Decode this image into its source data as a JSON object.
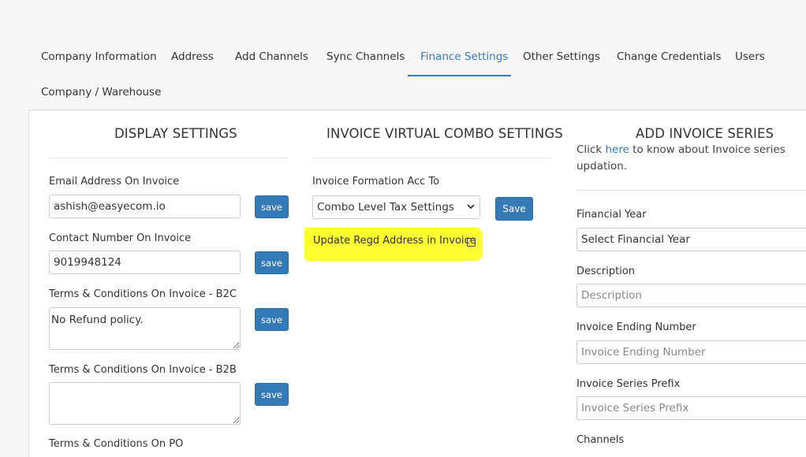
{
  "tabs": {
    "company_info": "Company Information",
    "address": "Address",
    "add_channels": "Add Channels",
    "sync_channels": "Sync Channels",
    "finance_settings": "Finance Settings",
    "other_settings": "Other Settings",
    "change_credentials": "Change Credentials",
    "users": "Users",
    "company_warehouse": "Company / Warehouse",
    "active": "Finance Settings"
  },
  "display_settings": {
    "title": "DISPLAY SETTINGS",
    "email_label": "Email Address On Invoice",
    "email_value": "ashish@easyecom.io",
    "contact_label": "Contact Number On Invoice",
    "contact_value": "9019948124",
    "tc_b2c_label": "Terms & Conditions On Invoice - B2C",
    "tc_b2c_value": "No Refund policy.",
    "tc_b2b_label": "Terms & Conditions On Invoice - B2B",
    "tc_b2b_value": "",
    "tc_po_label": "Terms & Conditions On PO",
    "save_label": "save"
  },
  "invoice_combo": {
    "title": "INVOICE VIRTUAL COMBO SETTINGS",
    "formation_label": "Invoice Formation Acc To",
    "formation_value": "Combo Level Tax Settings",
    "save_label": "Save",
    "update_regd_label": "Update Regd Address in Invoice",
    "update_regd_checked": false
  },
  "invoice_series": {
    "title": "ADD INVOICE SERIES",
    "help_prefix": "Click ",
    "help_link": "here",
    "help_suffix": " to know about Invoice series updation.",
    "financial_year_label": "Financial Year",
    "financial_year_value": "Select Financial Year",
    "description_label": "Description",
    "description_placeholder": "Description",
    "ending_number_label": "Invoice Ending Number",
    "ending_number_placeholder": "Invoice Ending Number",
    "prefix_label": "Invoice Series Prefix",
    "prefix_placeholder": "Invoice Series Prefix",
    "channels_label": "Channels"
  },
  "colors": {
    "accent": "#337ab7",
    "highlight": "#ffff33"
  },
  "icons": {
    "select_arrow": "chevron-down-icon"
  }
}
